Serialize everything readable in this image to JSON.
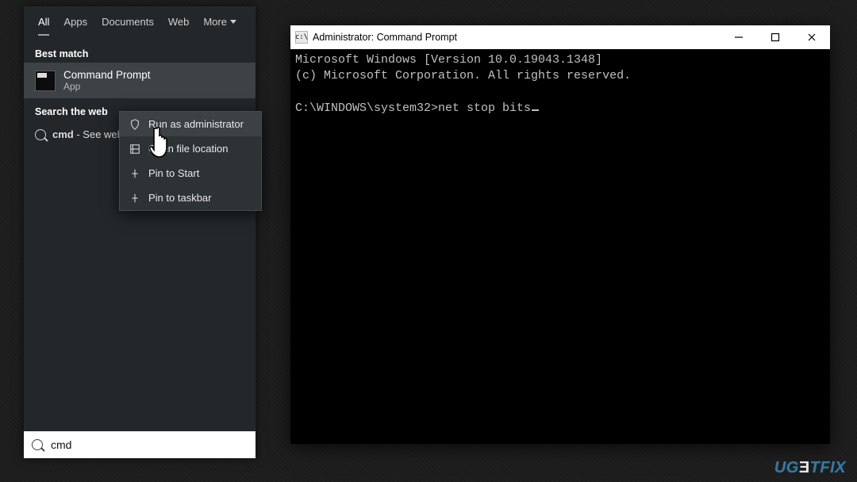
{
  "search": {
    "tabs": {
      "all": "All",
      "apps": "Apps",
      "documents": "Documents",
      "web": "Web",
      "more": "More"
    },
    "sections": {
      "best_match": "Best match",
      "search_web": "Search the web"
    },
    "best_match": {
      "title": "Command Prompt",
      "subtitle": "App"
    },
    "web": {
      "query": "cmd",
      "suffix": " - See web results"
    },
    "context_menu": {
      "run_admin": "Run as administrator",
      "open_location": "Open file location",
      "pin_start": "Pin to Start",
      "pin_taskbar": "Pin to taskbar"
    },
    "input_value": "cmd"
  },
  "cmd": {
    "title": "Administrator: Command Prompt",
    "line1": "Microsoft Windows [Version 10.0.19043.1348]",
    "line2": "(c) Microsoft Corporation. All rights reserved.",
    "prompt": "C:\\WINDOWS\\system32>",
    "command": "net stop bits"
  },
  "watermark": "UGETFIX"
}
